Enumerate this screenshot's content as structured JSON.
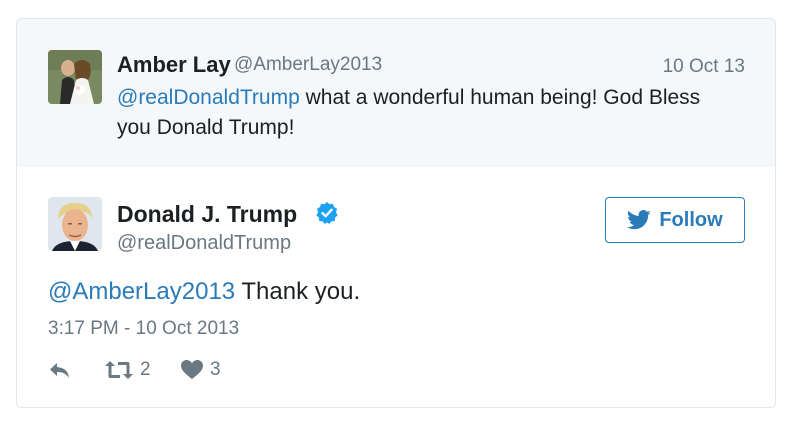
{
  "reply": {
    "avatar_icon": "wedding-photo-avatar",
    "name": "Amber Lay",
    "handle": "@AmberLay2013",
    "date": "10 Oct 13",
    "mention": "@realDonaldTrump",
    "text": " what a wonderful human being! God Bless you Donald Trump!"
  },
  "tweet": {
    "avatar_icon": "portrait-avatar",
    "name": "Donald J. Trump",
    "verified_icon": "verified-badge-icon",
    "handle": "@realDonaldTrump",
    "follow_label": "Follow",
    "mention": "@AmberLay2013",
    "text": " Thank you.",
    "timestamp": "3:17 PM - 10 Oct 2013",
    "retweet_count": "2",
    "like_count": "3"
  },
  "colors": {
    "link": "#2b7bb9",
    "muted": "#697882",
    "verified": "#1da1f2",
    "reply_background": "#f5f8fa"
  }
}
